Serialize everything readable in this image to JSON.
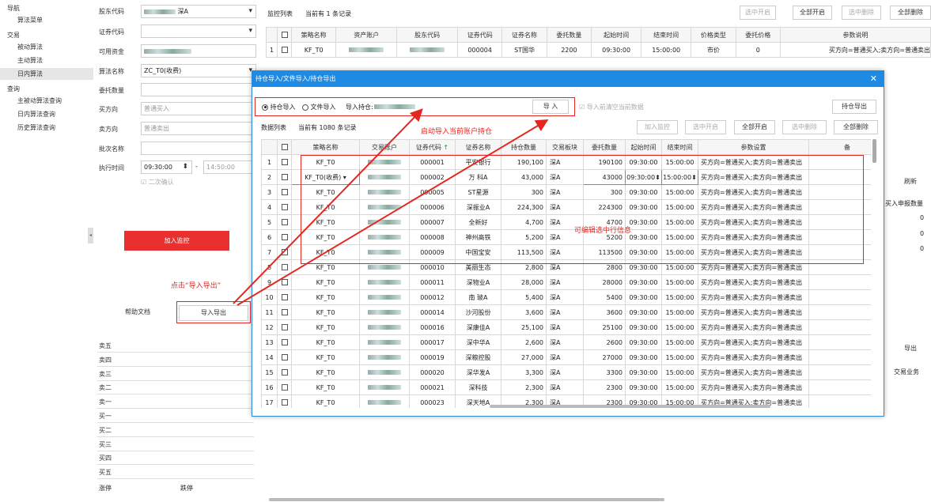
{
  "nav": {
    "header_nav": "导航",
    "algo_list": "算法菜单",
    "header_trade": "交易",
    "passive": "被动算法",
    "active": "主动算法",
    "intraday": "日内算法",
    "header_query": "查询",
    "q_passive": "主被动算法查询",
    "q_intraday": "日内算法查询",
    "q_history": "历史算法查询"
  },
  "form": {
    "shareholder_code_label": "股东代码",
    "shareholder_code_value": "深A",
    "security_code_label": "证券代码",
    "available_funds_label": "可用资金",
    "algo_name_label": "算法名称",
    "algo_name_value": "ZC_T0(收费)",
    "entrust_qty_label": "委托数量",
    "buy_dir_label": "买方向",
    "buy_dir_value": "普通买入",
    "sell_dir_label": "卖方向",
    "sell_dir_value": "普通卖出",
    "batch_name_label": "批次名称",
    "exec_time_label": "执行时间",
    "start_time": "09:30:00",
    "dash": "-",
    "end_time": "14:50:00",
    "second_confirm": "二次确认",
    "add_monitor": "加入监控",
    "hint_click": "点击“导入导出”",
    "help_doc": "帮助文档",
    "import_export": "导入导出"
  },
  "orderbook": [
    "卖五",
    "卖四",
    "卖三",
    "卖二",
    "卖一",
    "买一",
    "买二",
    "买三",
    "买四",
    "买五"
  ],
  "limit_up": "涨停",
  "limit_down": "跌停",
  "monitor": {
    "list_label": "监控列表",
    "count_text": "当前有  1  条记录",
    "btn_sel_on": "选中开启",
    "btn_all_on": "全部开启",
    "btn_sel_del": "选中删除",
    "btn_all_del": "全部删除",
    "headers": [
      "策略名称",
      "资产账户",
      "股东代码",
      "证券代码",
      "证券名称",
      "委托数量",
      "起始时间",
      "结束时间",
      "价格类型",
      "委托价格",
      "参数说明"
    ],
    "row": {
      "idx": "1",
      "strategy": "KF_T0",
      "code": "000004",
      "name": "ST国华",
      "qty": "2200",
      "start": "09:30:00",
      "end": "15:00:00",
      "ptype": "市价",
      "price": "0",
      "params": "买方向=普通买入;卖方向=普通卖出"
    }
  },
  "right": {
    "refresh": "刷新",
    "buy_qty": "买入申报数量",
    "zeros": [
      "0",
      "0",
      "0"
    ],
    "export": "导出",
    "business": "交易业务"
  },
  "modal": {
    "title": "持仓导入/文件导入/持仓导出",
    "opt_position": "持仓导入",
    "opt_file": "文件导入",
    "import_pos_label": "导入持仓:",
    "import_btn": "导  入",
    "clear_check": "导入前清空当前数据",
    "export_pos": "持仓导出",
    "hint_start": "启动导入当前账户持仓",
    "data_list": "数据列表",
    "count_text": "当前有  1080  条记录",
    "btn_add": "加入监控",
    "btn_sel_on": "选中开启",
    "btn_all_on": "全部开启",
    "btn_sel_del": "选中删除",
    "btn_all_del": "全部删除",
    "hint_edit": "可编辑选中行信息",
    "headers": [
      "策略名称",
      "交易账户",
      "证券代码",
      "证券名称",
      "持仓数量",
      "交易板块",
      "委托数量",
      "起始时间",
      "结束时间",
      "参数设置",
      "备"
    ],
    "rows": [
      [
        "1",
        "KF_T0",
        "000001",
        "平安银行",
        "190,100",
        "深A",
        "190100",
        "09:30:00",
        "15:00:00"
      ],
      [
        "2",
        "KF_T0(收费)",
        "000002",
        "万 科A",
        "43,000",
        "深A",
        "43000",
        "09:30:00",
        "15:00:00"
      ],
      [
        "3",
        "KF_T0",
        "000005",
        "ST星源",
        "300",
        "深A",
        "300",
        "09:30:00",
        "15:00:00"
      ],
      [
        "4",
        "KF_T0",
        "000006",
        "深振业A",
        "224,300",
        "深A",
        "224300",
        "09:30:00",
        "15:00:00"
      ],
      [
        "5",
        "KF_T0",
        "000007",
        "全新好",
        "4,700",
        "深A",
        "4700",
        "09:30:00",
        "15:00:00"
      ],
      [
        "6",
        "KF_T0",
        "000008",
        "神州高铁",
        "5,200",
        "深A",
        "5200",
        "09:30:00",
        "15:00:00"
      ],
      [
        "7",
        "KF_T0",
        "000009",
        "中国宝安",
        "113,500",
        "深A",
        "113500",
        "09:30:00",
        "15:00:00"
      ],
      [
        "8",
        "KF_T0",
        "000010",
        "美丽生态",
        "2,800",
        "深A",
        "2800",
        "09:30:00",
        "15:00:00"
      ],
      [
        "9",
        "KF_T0",
        "000011",
        "深物业A",
        "28,000",
        "深A",
        "28000",
        "09:30:00",
        "15:00:00"
      ],
      [
        "10",
        "KF_T0",
        "000012",
        "南 玻A",
        "5,400",
        "深A",
        "5400",
        "09:30:00",
        "15:00:00"
      ],
      [
        "11",
        "KF_T0",
        "000014",
        "沙河股份",
        "3,600",
        "深A",
        "3600",
        "09:30:00",
        "15:00:00"
      ],
      [
        "12",
        "KF_T0",
        "000016",
        "深康佳A",
        "25,100",
        "深A",
        "25100",
        "09:30:00",
        "15:00:00"
      ],
      [
        "13",
        "KF_T0",
        "000017",
        "深中华A",
        "2,600",
        "深A",
        "2600",
        "09:30:00",
        "15:00:00"
      ],
      [
        "14",
        "KF_T0",
        "000019",
        "深粮控股",
        "27,000",
        "深A",
        "27000",
        "09:30:00",
        "15:00:00"
      ],
      [
        "15",
        "KF_T0",
        "000020",
        "深华发A",
        "3,300",
        "深A",
        "3300",
        "09:30:00",
        "15:00:00"
      ],
      [
        "16",
        "KF_T0",
        "000021",
        "深科技",
        "2,300",
        "深A",
        "2300",
        "09:30:00",
        "15:00:00"
      ],
      [
        "17",
        "KF_T0",
        "000023",
        "深天地A",
        "2,300",
        "深A",
        "2300",
        "09:30:00",
        "15:00:00"
      ]
    ],
    "param_text": "买方向=普通买入;卖方向=普通卖出"
  },
  "colors": {
    "accent": "#1e8ae3",
    "red": "#e52620"
  }
}
